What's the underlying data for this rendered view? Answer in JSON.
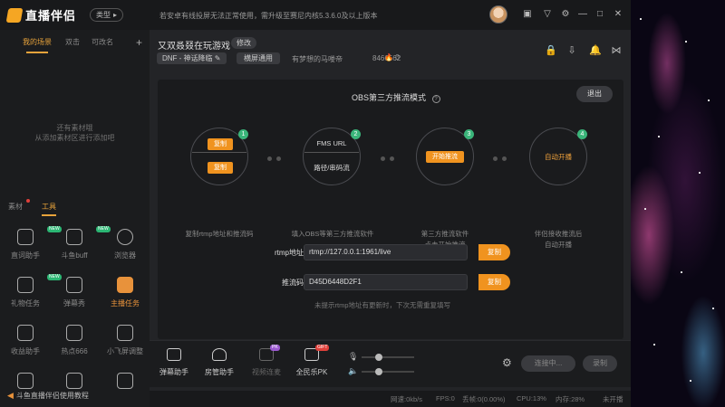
{
  "app": {
    "name": "直播伴侣",
    "type_button": "类型",
    "notice": "若安卓有线投屏无法正常使用，需升级至赛尼内核5.3.6.0及以上版本"
  },
  "left_panel": {
    "tabs": [
      "我的场景",
      "双击",
      "可改名"
    ],
    "empty_text_line1": "还有素材哦",
    "empty_text_line2": "从添加素材区进行添加吧",
    "section_tabs": [
      "素材",
      "工具"
    ],
    "tools": [
      {
        "label": "直词助手",
        "badge": "NEW",
        "icon": "download-icon"
      },
      {
        "label": "斗鱼buff",
        "badge": "NEW",
        "icon": "download-icon"
      },
      {
        "label": "浏览器",
        "badge": "",
        "icon": "browser-icon"
      },
      {
        "label": "礼物任务",
        "badge": "NEW",
        "icon": "download-icon"
      },
      {
        "label": "弹幕秀",
        "badge": "",
        "icon": "danmaku-show-icon"
      },
      {
        "label": "主播任务",
        "badge": "",
        "icon": "task-icon",
        "highlight": true
      },
      {
        "label": "收益助手",
        "badge": "",
        "icon": "download-icon"
      },
      {
        "label": "热点666",
        "badge": "",
        "icon": "download-icon"
      },
      {
        "label": "小飞屏调整",
        "badge": "",
        "icon": "plane-icon"
      },
      {
        "label": "",
        "badge": "",
        "icon": "download-icon"
      },
      {
        "label": "",
        "badge": "",
        "icon": "shield-icon"
      },
      {
        "label": "",
        "badge": "",
        "icon": "ad-icon"
      }
    ],
    "help_link": "斗鱼直播伴侣使用教程"
  },
  "room": {
    "title": "又双叒叕在玩游戏",
    "modify_label": "修改",
    "category": "DNF - 神话降临",
    "mode": "横屏通用",
    "host_name": "有梦想的马喽帝",
    "room_id": "8466562",
    "hot_value": "0"
  },
  "obs": {
    "title": "OBS第三方推流模式",
    "exit_label": "退出",
    "steps": [
      {
        "num": "1",
        "buttons": [
          "复制",
          "复制"
        ],
        "desc_line1": "复制rtmp地址和推流码",
        "desc_line2": ""
      },
      {
        "num": "2",
        "text_top": "FMS URL",
        "text_bottom": "路径/串码流",
        "desc_line1": "填入OBS等第三方推流软件",
        "desc_line2": ""
      },
      {
        "num": "3",
        "button": "开始推流",
        "desc_line1": "第三方推流软件",
        "desc_line2": "点击开始推流"
      },
      {
        "num": "4",
        "text": "自动开播",
        "desc_line1": "伴侣接收推流后",
        "desc_line2": "自动开播"
      }
    ],
    "rtmp_label": "rtmp地址",
    "rtmp_value": "rtmp://127.0.0.1:1961/live",
    "key_label": "推流码",
    "key_value": "D45D6448D2F1",
    "copy_label": "复制",
    "hint": "未提示rtmp地址有更新时，下次无需重复填写"
  },
  "bottom": {
    "tools": [
      {
        "label": "弹幕助手",
        "badge": "",
        "dim": false
      },
      {
        "label": "房管助手",
        "badge": "",
        "dim": false
      },
      {
        "label": "视频连麦",
        "badge": "PK",
        "dim": true
      },
      {
        "label": "全民乐PK",
        "badge": "GIFT",
        "dim": false
      }
    ],
    "mic_level": 0.3,
    "speaker_level": 0.3,
    "connect_label": "连接中...",
    "record_label": "录制"
  },
  "status": {
    "speed": "网速:0kb/s",
    "fps": "FPS:0",
    "drop": "丢帧:0(0.00%)",
    "cpu": "CPU:13%",
    "mem": "内存:28%",
    "live": "未开播"
  },
  "colors": {
    "accent": "#f0931f",
    "step_badge": "#3ab57a"
  }
}
